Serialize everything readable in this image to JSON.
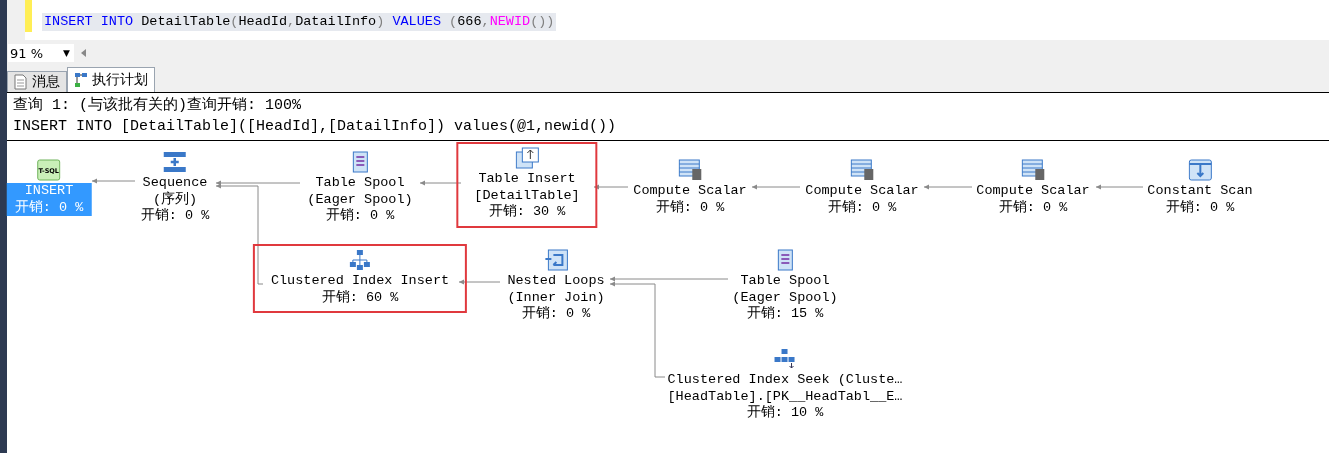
{
  "editor": {
    "tokens": [
      {
        "text": "INSERT INTO",
        "kind": "keyword"
      },
      {
        "text": " DetailTable",
        "kind": "plain"
      },
      {
        "text": "(",
        "kind": "punct"
      },
      {
        "text": "HeadId",
        "kind": "plain"
      },
      {
        "text": ",",
        "kind": "punct"
      },
      {
        "text": "DatailInfo",
        "kind": "plain"
      },
      {
        "text": ")",
        "kind": "punct"
      },
      {
        "text": " VALUES",
        "kind": "keyword"
      },
      {
        "text": " (",
        "kind": "punct"
      },
      {
        "text": "666",
        "kind": "plain"
      },
      {
        "text": ",",
        "kind": "punct"
      },
      {
        "text": "NEWID",
        "kind": "function"
      },
      {
        "text": "())",
        "kind": "punct"
      }
    ]
  },
  "zoom": {
    "value": "91 %",
    "arrow": "▼"
  },
  "tabs": [
    {
      "label": "消息",
      "kind": "messages",
      "selected": false
    },
    {
      "label": "执行计划",
      "kind": "plan",
      "selected": true
    }
  ],
  "results": {
    "query_header": "查询 1: (与该批有关的)查询开销: 100%",
    "statement": "INSERT INTO [DetailTable]([HeadId],[DatailInfo]) values(@1,newid())"
  },
  "plan": {
    "name": "INSERT",
    "cost": "开销: 0 %",
    "kind": "tsql",
    "icon_label": "T-SQL",
    "selected": true,
    "highlighted": false,
    "children": [
      {
        "name": "Sequence",
        "detail": "(序列)",
        "cost": "开销: 0 %",
        "kind": "sequence",
        "selected": false,
        "highlighted": false,
        "children": [
          {
            "name": "Table Spool",
            "detail": "(Eager Spool)",
            "cost": "开销: 0 %",
            "kind": "table-spool",
            "selected": false,
            "highlighted": false,
            "children": [
              {
                "name": "Table Insert",
                "detail": "[DetailTable]",
                "cost": "开销: 30 %",
                "kind": "table-insert",
                "selected": false,
                "highlighted": true,
                "children": [
                  {
                    "name": "Compute Scalar",
                    "cost": "开销: 0 %",
                    "kind": "compute-scalar",
                    "selected": false,
                    "highlighted": false,
                    "children": [
                      {
                        "name": "Compute Scalar",
                        "cost": "开销: 0 %",
                        "kind": "compute-scalar",
                        "selected": false,
                        "highlighted": false,
                        "children": [
                          {
                            "name": "Compute Scalar",
                            "cost": "开销: 0 %",
                            "kind": "compute-scalar",
                            "selected": false,
                            "highlighted": false,
                            "children": [
                              {
                                "name": "Constant Scan",
                                "cost": "开销: 0 %",
                                "kind": "constant-scan",
                                "selected": false,
                                "highlighted": false
                              }
                            ]
                          }
                        ]
                      }
                    ]
                  }
                ]
              }
            ]
          },
          {
            "name": "Clustered Index Insert",
            "cost": "开销: 60 %",
            "kind": "clustered-index-insert",
            "selected": false,
            "highlighted": true,
            "children": [
              {
                "name": "Nested Loops",
                "detail": "(Inner Join)",
                "cost": "开销: 0 %",
                "kind": "nested-loops",
                "selected": false,
                "highlighted": false,
                "children": [
                  {
                    "name": "Table Spool",
                    "detail": "(Eager Spool)",
                    "cost": "开销: 15 %",
                    "kind": "table-spool",
                    "selected": false,
                    "highlighted": false
                  },
                  {
                    "name": "Clustered Index Seek (Cluste…",
                    "detail": "[HeadTable].[PK__HeadTabl__E…",
                    "cost": "开销: 10 %",
                    "kind": "clustered-index-seek",
                    "selected": false,
                    "highlighted": false
                  }
                ]
              }
            ]
          }
        ]
      }
    ]
  }
}
